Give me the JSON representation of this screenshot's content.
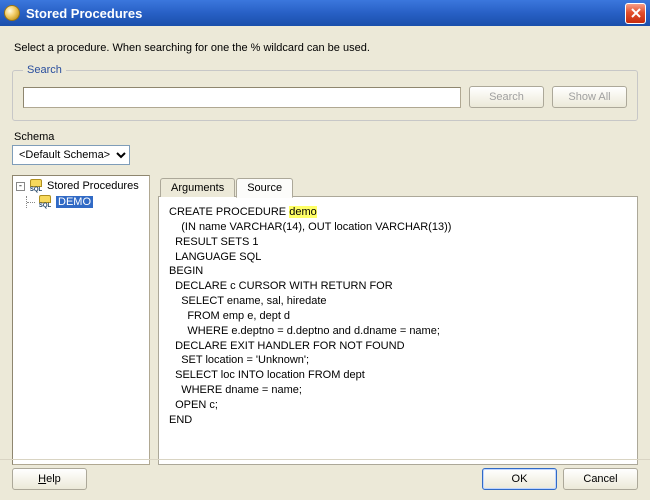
{
  "window": {
    "title": "Stored Procedures"
  },
  "instruction": "Select a procedure. When searching for one the % wildcard can be used.",
  "search": {
    "legend": "Search",
    "value": "",
    "placeholder": "",
    "search_btn": "Search",
    "showall_btn": "Show All"
  },
  "schema": {
    "label": "Schema",
    "selected": "<Default Schema>"
  },
  "tree": {
    "root_label": "Stored Procedures",
    "selected_item": "DEMO"
  },
  "tabs": {
    "arguments": "Arguments",
    "source": "Source"
  },
  "source": {
    "l1a": "CREATE PROCEDURE ",
    "l1b": "demo",
    "l2": "    (IN name VARCHAR(14), OUT location VARCHAR(13))",
    "l3": "  RESULT SETS 1",
    "l4": "  LANGUAGE SQL",
    "l5": "BEGIN",
    "l6": "  DECLARE c CURSOR WITH RETURN FOR",
    "l7": "    SELECT ename, sal, hiredate",
    "l8": "      FROM emp e, dept d",
    "l9": "      WHERE e.deptno = d.deptno and d.dname = name;",
    "l10": "  DECLARE EXIT HANDLER FOR NOT FOUND",
    "l11": "    SET location = 'Unknown';",
    "l12": "  SELECT loc INTO location FROM dept",
    "l13": "    WHERE dname = name;",
    "l14": "  OPEN c;",
    "l15": "END"
  },
  "footer": {
    "help": "Help",
    "ok": "OK",
    "cancel": "Cancel"
  },
  "colors": {
    "titlebar": "#2860c5",
    "highlight": "#ffff66",
    "selection": "#316ac5",
    "panel_bg": "#ece9d8"
  }
}
